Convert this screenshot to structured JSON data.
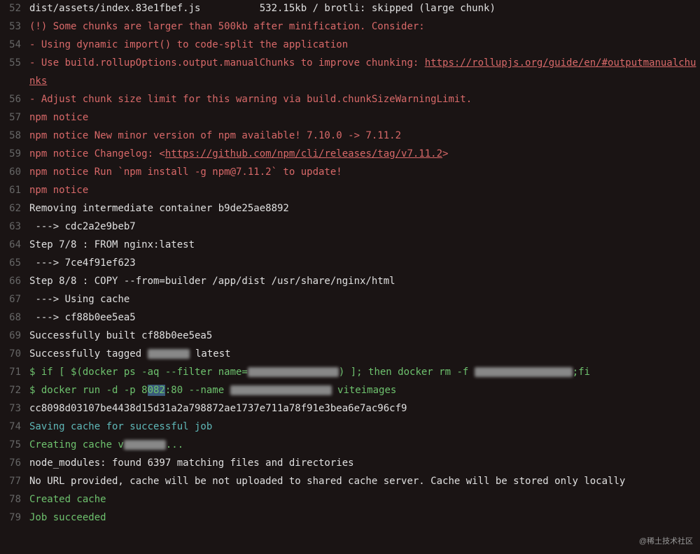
{
  "lines": [
    {
      "num": "52",
      "segments": [
        {
          "cls": "white",
          "text": "dist/assets/index.83e1fbef.js          532.15kb / brotli: skipped (large chunk)"
        }
      ]
    },
    {
      "num": "53",
      "segments": [
        {
          "cls": "red",
          "text": "(!) Some chunks are larger than 500kb after minification. Consider:"
        }
      ]
    },
    {
      "num": "54",
      "segments": [
        {
          "cls": "red",
          "text": "- Using dynamic import() to code-split the application"
        }
      ]
    },
    {
      "num": "55",
      "segments": [
        {
          "cls": "red",
          "text": "- Use build.rollupOptions.output.manualChunks to improve chunking: "
        },
        {
          "cls": "red link",
          "text": "https://rollupjs.org/guide/en/#outputmanualchunks"
        }
      ]
    },
    {
      "num": "56",
      "segments": [
        {
          "cls": "red",
          "text": "- Adjust chunk size limit for this warning via build.chunkSizeWarningLimit."
        }
      ]
    },
    {
      "num": "57",
      "segments": [
        {
          "cls": "red",
          "text": "npm notice"
        }
      ]
    },
    {
      "num": "58",
      "segments": [
        {
          "cls": "red",
          "text": "npm notice New minor version of npm available! 7.10.0 -> 7.11.2"
        }
      ]
    },
    {
      "num": "59",
      "segments": [
        {
          "cls": "red",
          "text": "npm notice Changelog: <"
        },
        {
          "cls": "red link",
          "text": "https://github.com/npm/cli/releases/tag/v7.11.2"
        },
        {
          "cls": "red",
          "text": ">"
        }
      ]
    },
    {
      "num": "60",
      "segments": [
        {
          "cls": "red",
          "text": "npm notice Run `npm install -g npm@7.11.2` to update!"
        }
      ]
    },
    {
      "num": "61",
      "segments": [
        {
          "cls": "red",
          "text": "npm notice"
        }
      ]
    },
    {
      "num": "62",
      "segments": [
        {
          "cls": "white",
          "text": "Removing intermediate container b9de25ae8892"
        }
      ]
    },
    {
      "num": "63",
      "segments": [
        {
          "cls": "white",
          "text": " ---> cdc2a2e9beb7"
        }
      ]
    },
    {
      "num": "64",
      "segments": [
        {
          "cls": "white",
          "text": "Step 7/8 : FROM nginx:latest"
        }
      ]
    },
    {
      "num": "65",
      "segments": [
        {
          "cls": "white",
          "text": " ---> 7ce4f91ef623"
        }
      ]
    },
    {
      "num": "66",
      "segments": [
        {
          "cls": "white",
          "text": "Step 8/8 : COPY --from=builder /app/dist /usr/share/nginx/html"
        }
      ]
    },
    {
      "num": "67",
      "segments": [
        {
          "cls": "white",
          "text": " ---> Using cache"
        }
      ]
    },
    {
      "num": "68",
      "segments": [
        {
          "cls": "white",
          "text": " ---> cf88b0ee5ea5"
        }
      ]
    },
    {
      "num": "69",
      "segments": [
        {
          "cls": "white",
          "text": "Successfully built cf88b0ee5ea5"
        }
      ]
    },
    {
      "num": "70",
      "segments": [
        {
          "cls": "white",
          "text": "Successfully tagged "
        },
        {
          "blur": "blur-w1"
        },
        {
          "cls": "white",
          "text": " latest"
        }
      ]
    },
    {
      "num": "71",
      "segments": [
        {
          "cls": "green",
          "text": "$ if [ $(docker ps -aq --filter name="
        },
        {
          "blur": "blur-w2"
        },
        {
          "cls": "green",
          "text": ") ]; then docker rm -f "
        },
        {
          "blur": "blur-w3"
        },
        {
          "cls": "green",
          "text": ";fi"
        }
      ]
    },
    {
      "num": "72",
      "segments": [
        {
          "cls": "green",
          "text": "$ docker run -d -p 8"
        },
        {
          "cls": "green highlight",
          "text": "082"
        },
        {
          "cls": "green",
          "text": ":80 --name "
        },
        {
          "blur": "blur-w4"
        },
        {
          "cls": "green",
          "text": " viteimages"
        }
      ]
    },
    {
      "num": "73",
      "segments": [
        {
          "cls": "white",
          "text": "cc8098d03107be4438d15d31a2a798872ae1737e711a78f91e3bea6e7ac96cf9"
        }
      ]
    },
    {
      "num": "74",
      "segments": [
        {
          "cls": "cyan",
          "text": "Saving cache for successful job"
        }
      ]
    },
    {
      "num": "75",
      "segments": [
        {
          "cls": "green",
          "text": "Creating cache v"
        },
        {
          "blur": "blur-w5"
        },
        {
          "cls": "green",
          "text": "..."
        }
      ]
    },
    {
      "num": "76",
      "segments": [
        {
          "cls": "white",
          "text": "node_modules: found 6397 matching files and directories"
        }
      ]
    },
    {
      "num": "77",
      "segments": [
        {
          "cls": "white",
          "text": "No URL provided, cache will be not uploaded to shared cache server. Cache will be stored only locally"
        }
      ]
    },
    {
      "num": "78",
      "segments": [
        {
          "cls": "green",
          "text": "Created cache"
        }
      ]
    },
    {
      "num": "79",
      "segments": [
        {
          "cls": "green",
          "text": "Job succeeded"
        }
      ]
    }
  ],
  "watermark": "@稀土技术社区"
}
